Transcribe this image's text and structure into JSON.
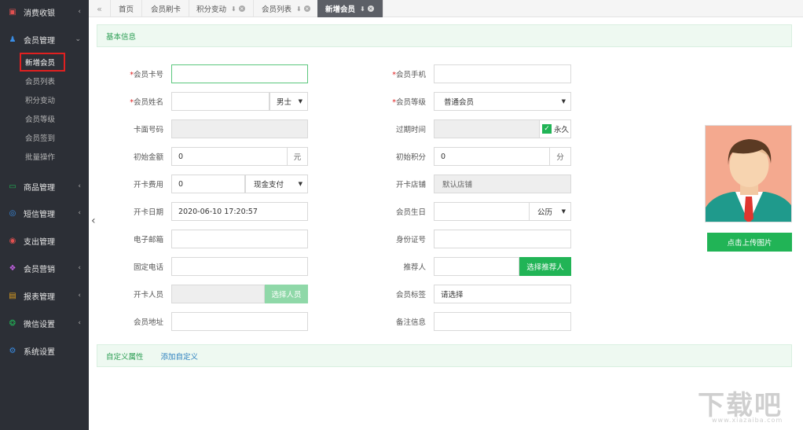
{
  "sidebar": {
    "items": [
      {
        "label": "消费收银",
        "icon": "receipt-icon",
        "color": "#e05050",
        "arrow": "‹"
      },
      {
        "label": "会员管理",
        "icon": "users-icon",
        "color": "#3a8ee6",
        "arrow": "⌄"
      },
      {
        "label": "商品管理",
        "icon": "goods-icon",
        "color": "#21b456",
        "arrow": "‹"
      },
      {
        "label": "短信管理",
        "icon": "sms-icon",
        "color": "#3a8ee6",
        "arrow": "‹"
      },
      {
        "label": "支出管理",
        "icon": "expense-icon",
        "color": "#e05050",
        "arrow": ""
      },
      {
        "label": "会员营销",
        "icon": "gift-icon",
        "color": "#c060e0",
        "arrow": "‹"
      },
      {
        "label": "报表管理",
        "icon": "report-icon",
        "color": "#e0a020",
        "arrow": "‹"
      },
      {
        "label": "微信设置",
        "icon": "wechat-icon",
        "color": "#21b456",
        "arrow": "‹"
      },
      {
        "label": "系统设置",
        "icon": "settings-icon",
        "color": "#3a8ee6",
        "arrow": ""
      }
    ],
    "sub_items": [
      "新增会员",
      "会员列表",
      "积分变动",
      "会员等级",
      "会员签到",
      "批量操作"
    ],
    "collapse_icon": "‹"
  },
  "tabs": {
    "back_icon": "«",
    "items": [
      {
        "label": "首页"
      },
      {
        "label": "会员刷卡"
      },
      {
        "label": "积分变动"
      },
      {
        "label": "会员列表"
      },
      {
        "label": "新增会员"
      }
    ]
  },
  "sections": {
    "basic": "基本信息",
    "custom": "自定义属性",
    "add_custom": "添加自定义"
  },
  "form": {
    "card_no": {
      "label": "会员卡号",
      "value": ""
    },
    "mobile": {
      "label": "会员手机",
      "value": ""
    },
    "name": {
      "label": "会员姓名",
      "value": "",
      "gender": "男士"
    },
    "level": {
      "label": "会员等级",
      "value": "普通会员"
    },
    "face_no": {
      "label": "卡面号码",
      "value": ""
    },
    "expire": {
      "label": "过期时间",
      "value": "",
      "forever": "永久"
    },
    "init_amount": {
      "label": "初始金额",
      "value": "0",
      "unit": "元"
    },
    "init_points": {
      "label": "初始积分",
      "value": "0",
      "unit": "分"
    },
    "card_fee": {
      "label": "开卡费用",
      "value": "0",
      "pay": "现金支付"
    },
    "card_store": {
      "label": "开卡店铺",
      "value": "默认店铺"
    },
    "card_date": {
      "label": "开卡日期",
      "value": "2020-06-10 17:20:57"
    },
    "birthday": {
      "label": "会员生日",
      "value": "",
      "calendar": "公历"
    },
    "email": {
      "label": "电子邮箱",
      "value": ""
    },
    "id_no": {
      "label": "身份证号",
      "value": ""
    },
    "phone": {
      "label": "固定电话",
      "value": ""
    },
    "referrer": {
      "label": "推荐人",
      "value": "",
      "button": "选择推荐人"
    },
    "operator": {
      "label": "开卡人员",
      "value": "",
      "button": "选择人员"
    },
    "tags": {
      "label": "会员标签",
      "value": "请选择"
    },
    "address": {
      "label": "会员地址",
      "value": ""
    },
    "remark": {
      "label": "备注信息",
      "value": ""
    }
  },
  "avatar": {
    "upload_label": "点击上传图片"
  },
  "watermark": {
    "text": "下载吧",
    "sub": "www.xiazaiba.com"
  },
  "colors": {
    "accent": "#21b456",
    "sidebar": "#2c2f36",
    "required": "#e02020"
  }
}
